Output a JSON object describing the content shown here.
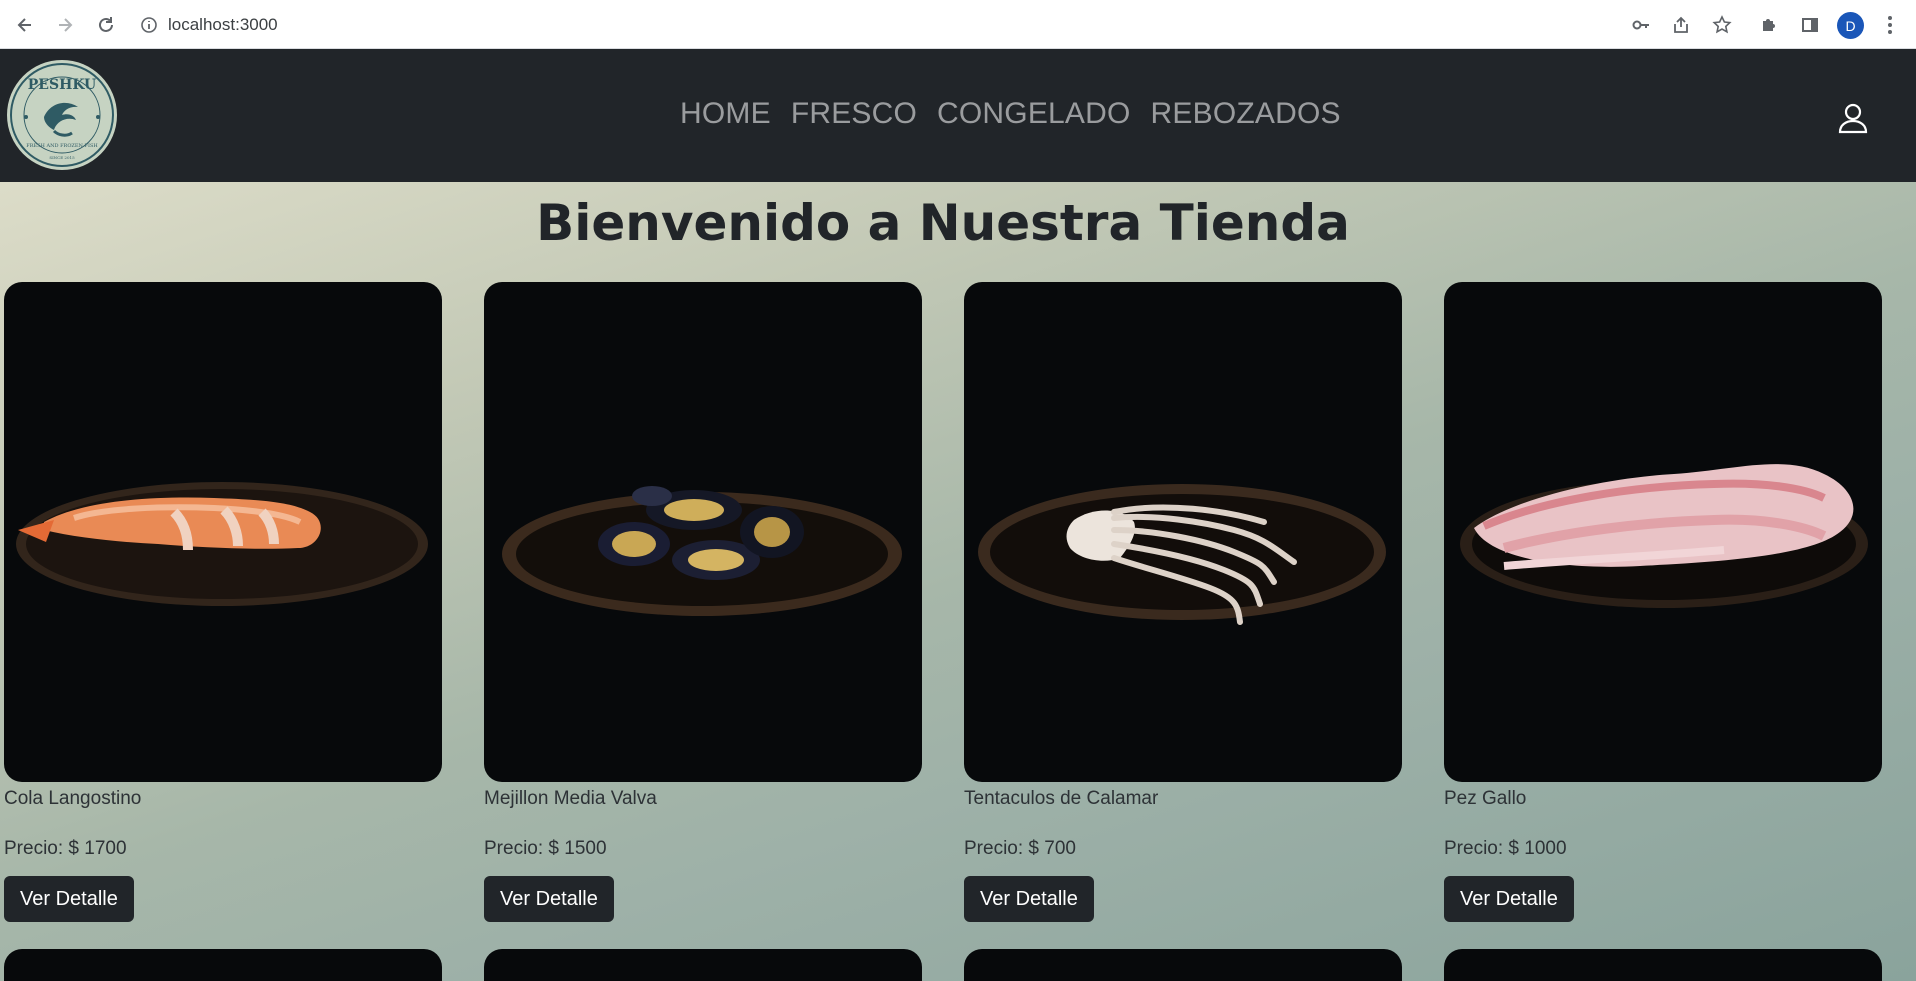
{
  "browser": {
    "url": "localhost:3000",
    "profile_initial": "D"
  },
  "navbar": {
    "logo_text": "PESHKU",
    "logo_subtext": "FRESH AND FROZEN FISH",
    "logo_since": "SINCE 2015",
    "items": [
      {
        "label": "HOME"
      },
      {
        "label": "FRESCO"
      },
      {
        "label": "CONGELADO"
      },
      {
        "label": "REBOZADOS"
      }
    ]
  },
  "main": {
    "title": "Bienvenido a Nuestra Tienda",
    "products": [
      {
        "name": "Cola Langostino",
        "price": "Precio: $ 1700",
        "button": "Ver Detalle",
        "image": "shrimp-tails"
      },
      {
        "name": "Mejillon Media Valva",
        "price": "Precio: $ 1500",
        "button": "Ver Detalle",
        "image": "mussels"
      },
      {
        "name": "Tentaculos de Calamar",
        "price": "Precio: $ 700",
        "button": "Ver Detalle",
        "image": "squid-tentacles"
      },
      {
        "name": "Pez Gallo",
        "price": "Precio: $ 1000",
        "button": "Ver Detalle",
        "image": "fish-fillet"
      }
    ]
  }
}
